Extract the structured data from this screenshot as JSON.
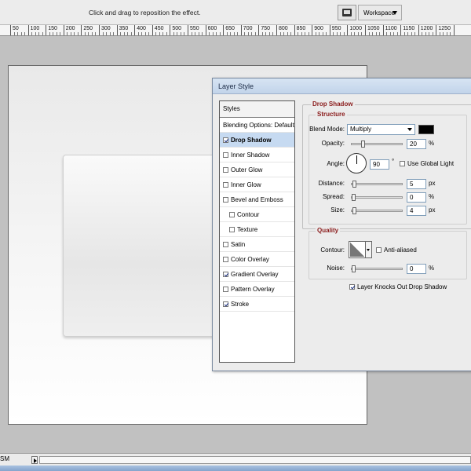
{
  "topbar": {
    "hint": "Click and drag to reposition the effect.",
    "workspace_label": "Workspace",
    "workspace_icon": "workspace-icon"
  },
  "ruler": {
    "labels": [
      "50",
      "100",
      "150",
      "200",
      "250",
      "300",
      "350",
      "400",
      "450",
      "500",
      "550",
      "600",
      "650",
      "700",
      "750",
      "800",
      "850",
      "900",
      "950",
      "1000",
      "1050",
      "1100",
      "1150",
      "1200",
      "1250"
    ]
  },
  "status": {
    "zoom": "SM"
  },
  "dialog": {
    "title": "Layer Style",
    "styles_header": "Styles",
    "styles": [
      {
        "label": "Blending Options: Default",
        "checkbox": false,
        "checked": false,
        "sub": false,
        "selected": false
      },
      {
        "label": "Drop Shadow",
        "checkbox": true,
        "checked": true,
        "sub": false,
        "selected": true
      },
      {
        "label": "Inner Shadow",
        "checkbox": true,
        "checked": false,
        "sub": false,
        "selected": false
      },
      {
        "label": "Outer Glow",
        "checkbox": true,
        "checked": false,
        "sub": false,
        "selected": false
      },
      {
        "label": "Inner Glow",
        "checkbox": true,
        "checked": false,
        "sub": false,
        "selected": false
      },
      {
        "label": "Bevel and Emboss",
        "checkbox": true,
        "checked": false,
        "sub": false,
        "selected": false
      },
      {
        "label": "Contour",
        "checkbox": true,
        "checked": false,
        "sub": true,
        "selected": false
      },
      {
        "label": "Texture",
        "checkbox": true,
        "checked": false,
        "sub": true,
        "selected": false
      },
      {
        "label": "Satin",
        "checkbox": true,
        "checked": false,
        "sub": false,
        "selected": false
      },
      {
        "label": "Color Overlay",
        "checkbox": true,
        "checked": false,
        "sub": false,
        "selected": false
      },
      {
        "label": "Gradient Overlay",
        "checkbox": true,
        "checked": true,
        "sub": false,
        "selected": false
      },
      {
        "label": "Pattern Overlay",
        "checkbox": true,
        "checked": false,
        "sub": false,
        "selected": false
      },
      {
        "label": "Stroke",
        "checkbox": true,
        "checked": true,
        "sub": false,
        "selected": false
      }
    ],
    "drop_shadow": {
      "heading": "Drop Shadow",
      "structure_heading": "Structure",
      "blend_mode_label": "Blend Mode:",
      "blend_mode_value": "Multiply",
      "shadow_color": "#000000",
      "opacity_label": "Opacity:",
      "opacity_value": "20",
      "opacity_level": 0.2,
      "percent": "%",
      "angle_label": "Angle:",
      "angle_value": "90",
      "degree": "°",
      "use_global_light_label": "Use Global Light",
      "use_global_light": false,
      "distance_label": "Distance:",
      "distance_value": "5",
      "distance_level": 0.02,
      "spread_label": "Spread:",
      "spread_value": "0",
      "spread_level": 0,
      "size_label": "Size:",
      "size_value": "4",
      "size_level": 0.02,
      "px": "px",
      "quality_heading": "Quality",
      "contour_label": "Contour:",
      "anti_aliased_label": "Anti-aliased",
      "anti_aliased": false,
      "noise_label": "Noise:",
      "noise_value": "0",
      "noise_level": 0,
      "knockout_label": "Layer Knocks Out Drop Shadow",
      "knockout": true
    }
  }
}
